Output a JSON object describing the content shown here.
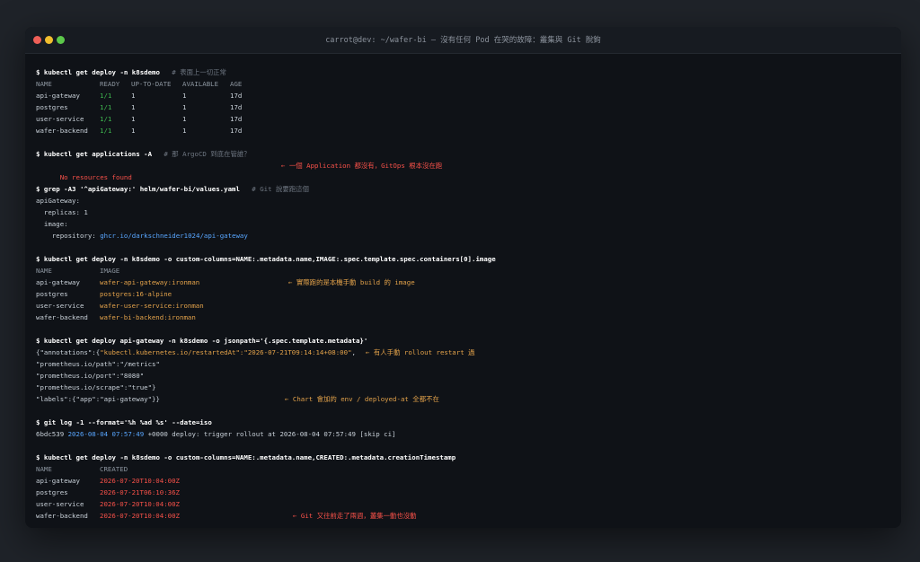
{
  "window": {
    "title": "carrot@dev: ~/wafer-bi — 沒有任何 Pod 在哭的故障：叢集與 Git 脫鉤"
  },
  "blocks": {
    "b1": {
      "cmd": "$ kubectl get deploy -n k8sdemo",
      "comment": "# 表面上一切正常",
      "headers": [
        "NAME",
        "READY",
        "UP-TO-DATE",
        "AVAILABLE",
        "AGE"
      ],
      "rows": [
        [
          "api-gateway",
          "1/1",
          "1",
          "1",
          "17d"
        ],
        [
          "postgres",
          "1/1",
          "1",
          "1",
          "17d"
        ],
        [
          "user-service",
          "1/1",
          "1",
          "1",
          "17d"
        ],
        [
          "wafer-backend",
          "1/1",
          "1",
          "1",
          "17d"
        ]
      ]
    },
    "b2": {
      "cmd": "$ kubectl get applications -A",
      "comment": "# 那 ArgoCD 到底在管誰？",
      "output": "No resources found",
      "note": "← 一個 Application 都沒有，GitOps 根本沒在跑"
    },
    "b3": {
      "cmd": "$ grep -A3 '^apiGateway:' helm/wafer-bi/values.yaml",
      "comment": "# Git 說要跑這個",
      "lines": [
        "apiGateway:",
        "  replicas: 1",
        "  image:"
      ],
      "repo_key": "    repository: ",
      "repo_value": "ghcr.io/darkschneider1024/api-gateway"
    },
    "b4": {
      "cmd": "$ kubectl get deploy -n k8sdemo -o custom-columns=NAME:.metadata.name,IMAGE:.spec.template.spec.containers[0].image",
      "headers": [
        "NAME",
        "IMAGE"
      ],
      "rows": [
        [
          "api-gateway",
          "wafer-api-gateway:ironman"
        ],
        [
          "postgres",
          "postgres:16-alpine"
        ],
        [
          "user-service",
          "wafer-user-service:ironman"
        ],
        [
          "wafer-backend",
          "wafer-bi-backend:ironman"
        ]
      ],
      "note": "← 實際跑的是本機手動 build 的 image"
    },
    "b5": {
      "cmd": "$ kubectl get deploy api-gateway -n k8sdemo -o jsonpath='{.spec.template.metadata}'",
      "l1a": "{\"annotations\":{",
      "l1b": "\"kubectl.kubernetes.io/restartedAt\":\"2026-07-21T09:14:14+08:00\"",
      "l1c": ",",
      "note1": "← 有人手動 rollout restart 過",
      "l2": "\"prometheus.io/path\":\"/metrics\"",
      "l3": "\"prometheus.io/port\":\"8080\"",
      "l4": "\"prometheus.io/scrape\":\"true\"}",
      "l5": "\"labels\":{\"app\":\"api-gateway\"}}",
      "note2": "← Chart 會加的 env / deployed-at 全都不在"
    },
    "b6": {
      "cmd": "$ git log -1 --format='%h %ad %s' --date=iso",
      "hash": "6bdc539",
      "date": "2026-08-04 07:57:49",
      "rest": " +0000 deploy: trigger rollout at 2026-08-04 07:57:49 [skip ci]"
    },
    "b7": {
      "cmd": "$ kubectl get deploy -n k8sdemo -o custom-columns=NAME:.metadata.name,CREATED:.metadata.creationTimestamp",
      "headers": [
        "NAME",
        "CREATED"
      ],
      "rows": [
        [
          "api-gateway",
          "2026-07-20T10:04:00Z"
        ],
        [
          "postgres",
          "2026-07-21T06:10:36Z"
        ],
        [
          "user-service",
          "2026-07-20T10:04:00Z"
        ],
        [
          "wafer-backend",
          "2026-07-20T10:04:00Z"
        ]
      ],
      "note": "← Git 又往前走了兩週，叢集一動也沒動"
    }
  },
  "colors": {
    "background": "#1f2329",
    "terminal": "#0f1217",
    "green": "#3fb950",
    "red": "#f85149",
    "orange": "#e3a24a",
    "blue": "#58a6ff"
  }
}
